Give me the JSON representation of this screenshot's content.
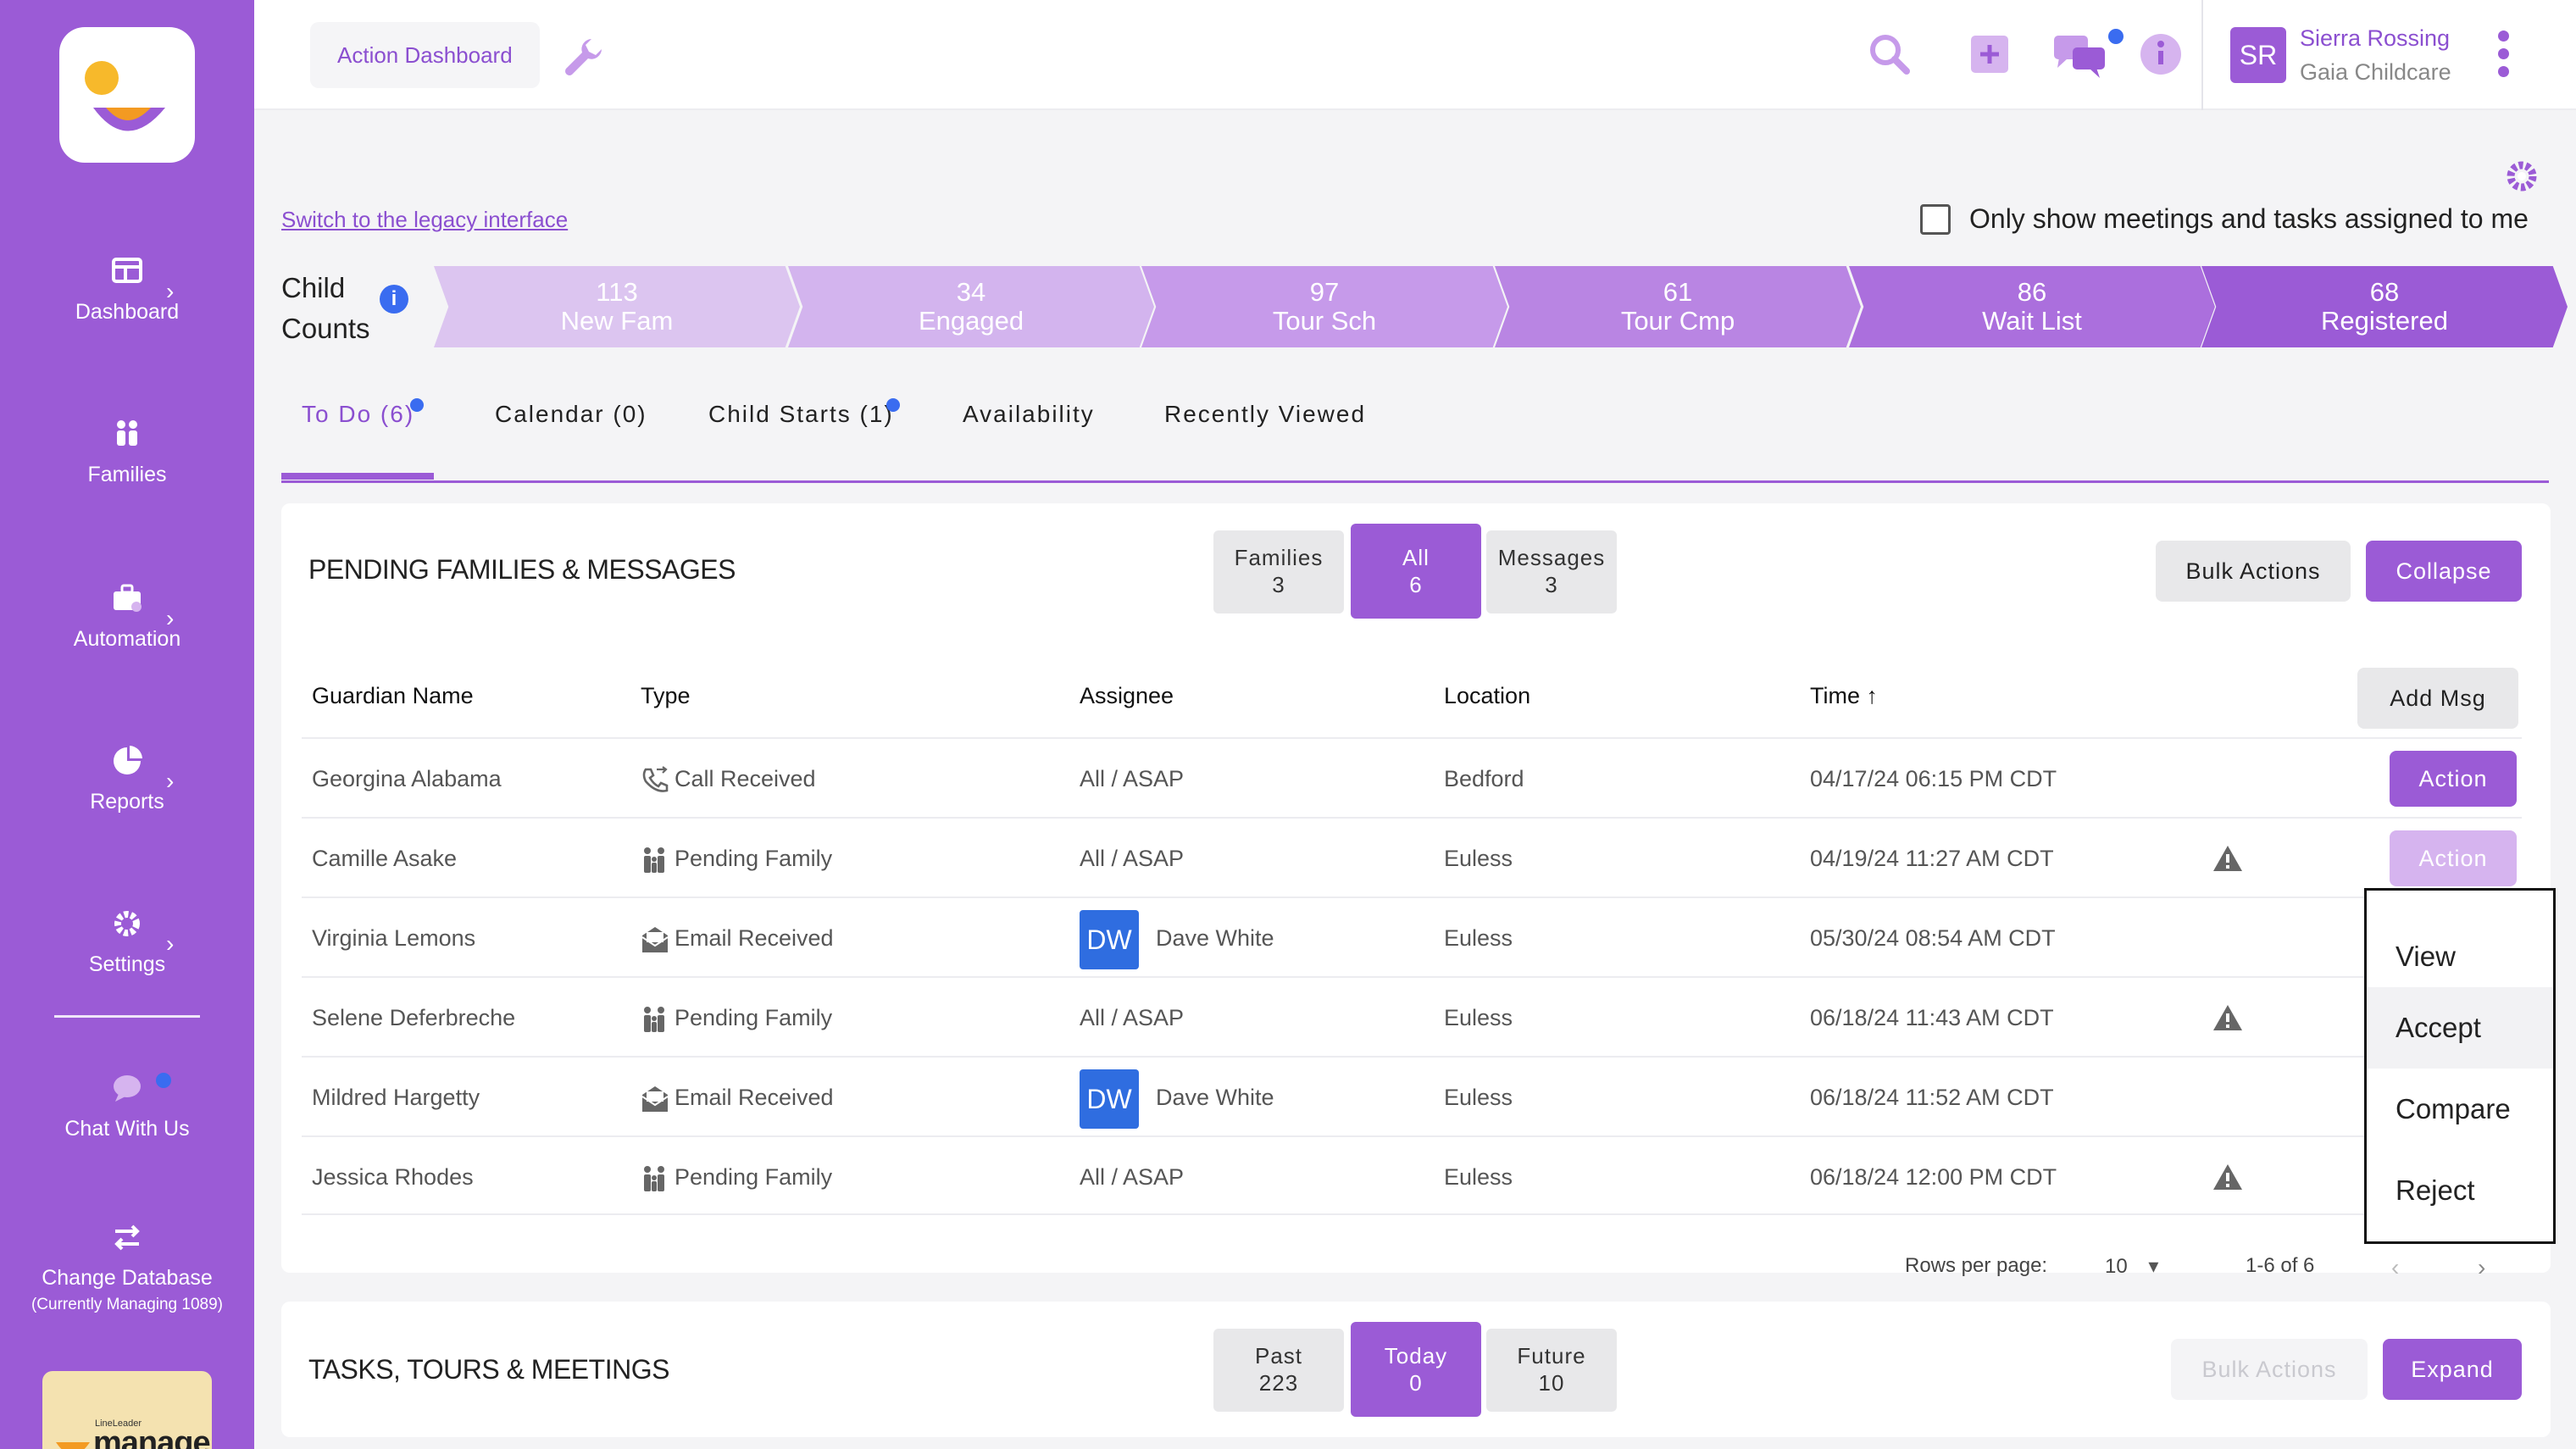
{
  "sidebar": {
    "items": [
      {
        "label": "Dashboard"
      },
      {
        "label": "Families"
      },
      {
        "label": "Automation"
      },
      {
        "label": "Reports"
      },
      {
        "label": "Settings"
      },
      {
        "label": "Chat With Us"
      },
      {
        "label": "Change Database"
      }
    ],
    "db_note": "(Currently Managing 1089)",
    "brand_small": "LineLeader",
    "brand_big": "manage"
  },
  "topbar": {
    "breadcrumb": "Action Dashboard",
    "user_initials": "SR",
    "user_name": "Sierra Rossing",
    "user_org": "Gaia Childcare"
  },
  "main": {
    "legacy_link": "Switch to the legacy interface",
    "only_show_label": "Only show meetings and tasks assigned to me",
    "child_counts_label": [
      "Child",
      "Counts"
    ],
    "funnel": [
      {
        "count": "113",
        "label": "New Fam",
        "color": "#dcc5f0"
      },
      {
        "count": "34",
        "label": "Engaged",
        "color": "#d3b4ee"
      },
      {
        "count": "97",
        "label": "Tour Sch",
        "color": "#c69aea"
      },
      {
        "count": "61",
        "label": "Tour Cmp",
        "color": "#b985e3"
      },
      {
        "count": "86",
        "label": "Wait List",
        "color": "#ab6fdd"
      },
      {
        "count": "68",
        "label": "Registered",
        "color": "#9b5bd6"
      }
    ],
    "tabs": [
      {
        "label": "To Do (6)"
      },
      {
        "label": "Calendar (0)"
      },
      {
        "label": "Child Starts (1)"
      },
      {
        "label": "Availability"
      },
      {
        "label": "Recently Viewed"
      }
    ]
  },
  "pending": {
    "title": "PENDING FAMILIES & MESSAGES",
    "segments": [
      {
        "label": "Families",
        "count": "3"
      },
      {
        "label": "All",
        "count": "6"
      },
      {
        "label": "Messages",
        "count": "3"
      }
    ],
    "bulk_actions": "Bulk Actions",
    "collapse": "Collapse",
    "add_msg": "Add Msg",
    "columns": [
      "Guardian Name",
      "Type",
      "Assignee",
      "Location",
      "Time"
    ],
    "sort_arrow": "↑",
    "rows": [
      {
        "name": "Georgina Alabama",
        "type": "Call Received",
        "assignee": "All / ASAP",
        "location": "Bedford",
        "time": "04/17/24 06:15 PM CDT"
      },
      {
        "name": "Camille Asake",
        "type": "Pending Family",
        "assignee": "All / ASAP",
        "location": "Euless",
        "time": "04/19/24 11:27 AM CDT"
      },
      {
        "name": "Virginia Lemons",
        "type": "Email Received",
        "assignee_initials": "DW",
        "assignee": "Dave White",
        "location": "Euless",
        "time": "05/30/24 08:54 AM CDT"
      },
      {
        "name": "Selene Deferbreche",
        "type": "Pending Family",
        "assignee": "All / ASAP",
        "location": "Euless",
        "time": "06/18/24 11:43 AM CDT"
      },
      {
        "name": "Mildred Hargetty",
        "type": "Email Received",
        "assignee_initials": "DW",
        "assignee": "Dave White",
        "location": "Euless",
        "time": "06/18/24 11:52 AM CDT"
      },
      {
        "name": "Jessica Rhodes",
        "type": "Pending Family",
        "assignee": "All / ASAP",
        "location": "Euless",
        "time": "06/18/24 12:00 PM CDT"
      }
    ],
    "action_label": "Action",
    "menu": [
      "View",
      "Accept",
      "Compare",
      "Reject"
    ],
    "rows_per_page_label": "Rows per page:",
    "rows_per_page": "10",
    "range": "1-6 of 6"
  },
  "tasks": {
    "title": "TASKS, TOURS & MEETINGS",
    "segments": [
      {
        "label": "Past",
        "count": "223"
      },
      {
        "label": "Today",
        "count": "0"
      },
      {
        "label": "Future",
        "count": "10"
      }
    ],
    "bulk_actions": "Bulk Actions",
    "expand": "Expand"
  }
}
